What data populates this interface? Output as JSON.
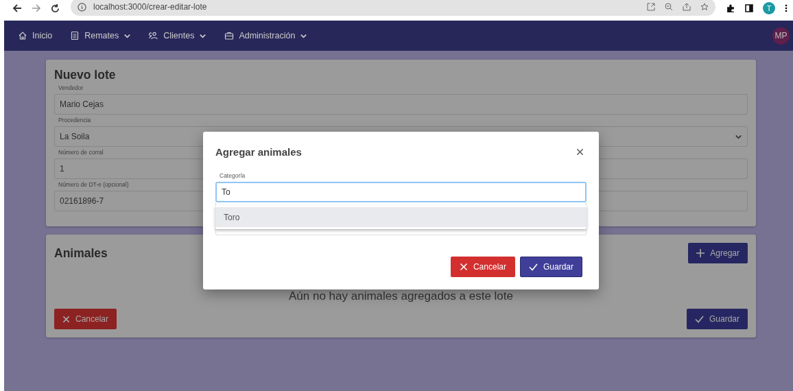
{
  "browser": {
    "url": "localhost:3000/crear-editar-lote",
    "profile_initial": "T"
  },
  "navbar": {
    "items": [
      {
        "label": "Inicio",
        "dropdown": false
      },
      {
        "label": "Remates",
        "dropdown": true
      },
      {
        "label": "Clientes",
        "dropdown": true
      },
      {
        "label": "Administración",
        "dropdown": true
      }
    ],
    "avatar": "MP"
  },
  "lot_form": {
    "title": "Nuevo lote",
    "fields": [
      {
        "kind": "text",
        "label": "Vendedor",
        "value": "Mario Cejas"
      },
      {
        "kind": "select",
        "label": "Procedencia",
        "value": "La Soila"
      },
      {
        "kind": "text",
        "label": "Número de corral",
        "value": "1"
      },
      {
        "kind": "text",
        "label": "Número de DT-e (opcional)",
        "value": "02161896-7"
      }
    ]
  },
  "animals": {
    "title": "Animales",
    "add_button": "Agregar",
    "empty_message": "Aún no hay animales agregados a este lote",
    "cancel_button": "Cancelar",
    "save_button": "Guardar"
  },
  "dialog": {
    "title": "Agregar animales",
    "field": {
      "label": "Categoría",
      "value": "To",
      "focused": true
    },
    "suggestions": [
      {
        "label": "Toro",
        "selected": true
      }
    ],
    "cancel_button": "Cancelar",
    "save_button": "Guardar"
  }
}
